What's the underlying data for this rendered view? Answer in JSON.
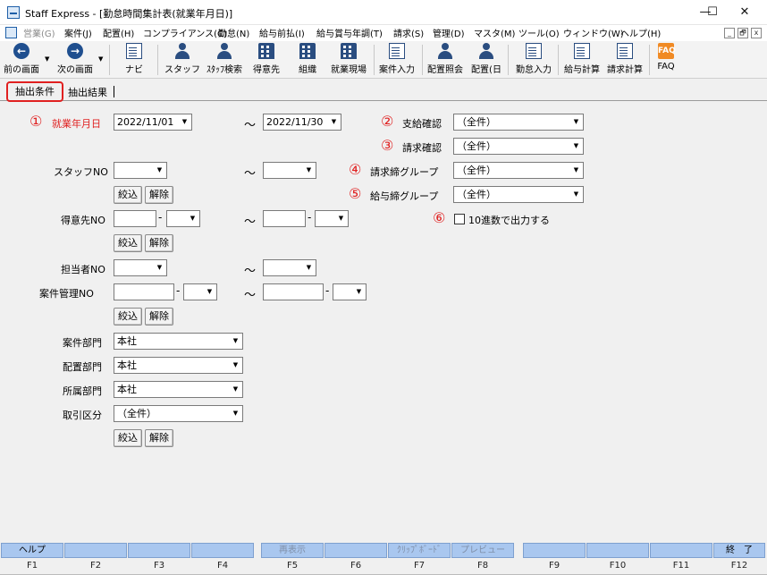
{
  "window": {
    "title": "Staff Express - [勤怠時間集計表(就業年月日)]",
    "minimize": "—",
    "maximize": "☐",
    "close": "✕"
  },
  "menu": {
    "items": [
      "営業(G)",
      "案件(J)",
      "配置(H)",
      "コンプライアンス(C)",
      "勤怠(N)",
      "給与前払(I)",
      "給与賞与年調(T)",
      "請求(S)",
      "管理(D)",
      "マスタ(M)",
      "ツール(O)",
      "ウィンドウ(W)",
      "ヘルプ(H)"
    ],
    "mdi_min": "_",
    "mdi_restore": "🗗",
    "mdi_close": "x"
  },
  "toolbar": {
    "back": "前の画面",
    "next": "次の画面",
    "navi": "ナビ",
    "staff": "スタッフ",
    "staff_search": "ｽﾀｯﾌ検索",
    "client": "得意先",
    "org": "組織",
    "site": "就業現場",
    "case_input": "案件入力",
    "placement_inquiry": "配置照会",
    "placement_day": "配置(日",
    "attendance_input": "勤怠入力",
    "payroll_calc": "給与計算",
    "billing_calc": "請求計算",
    "faq": "FAQ",
    "faq_icon": "FAQ"
  },
  "tabs": {
    "conditions": "抽出条件",
    "results": "抽出結果"
  },
  "form": {
    "markers": [
      "①",
      "②",
      "③",
      "④",
      "⑤",
      "⑥"
    ],
    "tilde": "～",
    "dash": "-",
    "work_date": {
      "label": "就業年月日",
      "from": "2022/11/01",
      "to": "2022/11/30"
    },
    "staff_no": {
      "label": "スタッフNO"
    },
    "client_no": {
      "label": "得意先NO"
    },
    "manager_no": {
      "label": "担当者NO"
    },
    "case_no": {
      "label": "案件管理NO"
    },
    "case_dept": {
      "label": "案件部門",
      "value": "本社"
    },
    "place_dept": {
      "label": "配置部門",
      "value": "本社"
    },
    "belong_dept": {
      "label": "所属部門",
      "value": "本社"
    },
    "trade_type": {
      "label": "取引区分",
      "value": "（全件）"
    },
    "pay_confirm": {
      "label": "支給確認",
      "value": "（全件）"
    },
    "bill_confirm": {
      "label": "請求確認",
      "value": "（全件）"
    },
    "bill_group": {
      "label": "請求締グループ",
      "value": "（全件）"
    },
    "pay_group": {
      "label": "給与締グループ",
      "value": "（全件）"
    },
    "decimal_output": {
      "label": "10進数で出力する",
      "checked": false
    },
    "narrow_btn": "絞込",
    "clear_btn": "解除"
  },
  "fkeys": [
    {
      "key": "F1",
      "label": "ヘルプ",
      "enabled": true
    },
    {
      "key": "F2",
      "label": "",
      "enabled": false
    },
    {
      "key": "F3",
      "label": "",
      "enabled": false
    },
    {
      "key": "F4",
      "label": "",
      "enabled": false
    },
    {
      "key": "F5",
      "label": "再表示",
      "enabled": false
    },
    {
      "key": "F6",
      "label": "",
      "enabled": false
    },
    {
      "key": "F7",
      "label": "ｸﾘｯﾌﾟﾎﾞｰﾄﾞ",
      "enabled": false
    },
    {
      "key": "F8",
      "label": "プレビュー",
      "enabled": false
    },
    {
      "key": "F9",
      "label": "",
      "enabled": false
    },
    {
      "key": "F10",
      "label": "",
      "enabled": false
    },
    {
      "key": "F11",
      "label": "",
      "enabled": false
    },
    {
      "key": "F12",
      "label": "終　了",
      "enabled": true
    }
  ],
  "colors": {
    "accent_red": "#e02020",
    "fkey_blue": "#a9c7ef",
    "icon_navy": "#1f4f8f",
    "faq_orange": "#f08a24"
  }
}
